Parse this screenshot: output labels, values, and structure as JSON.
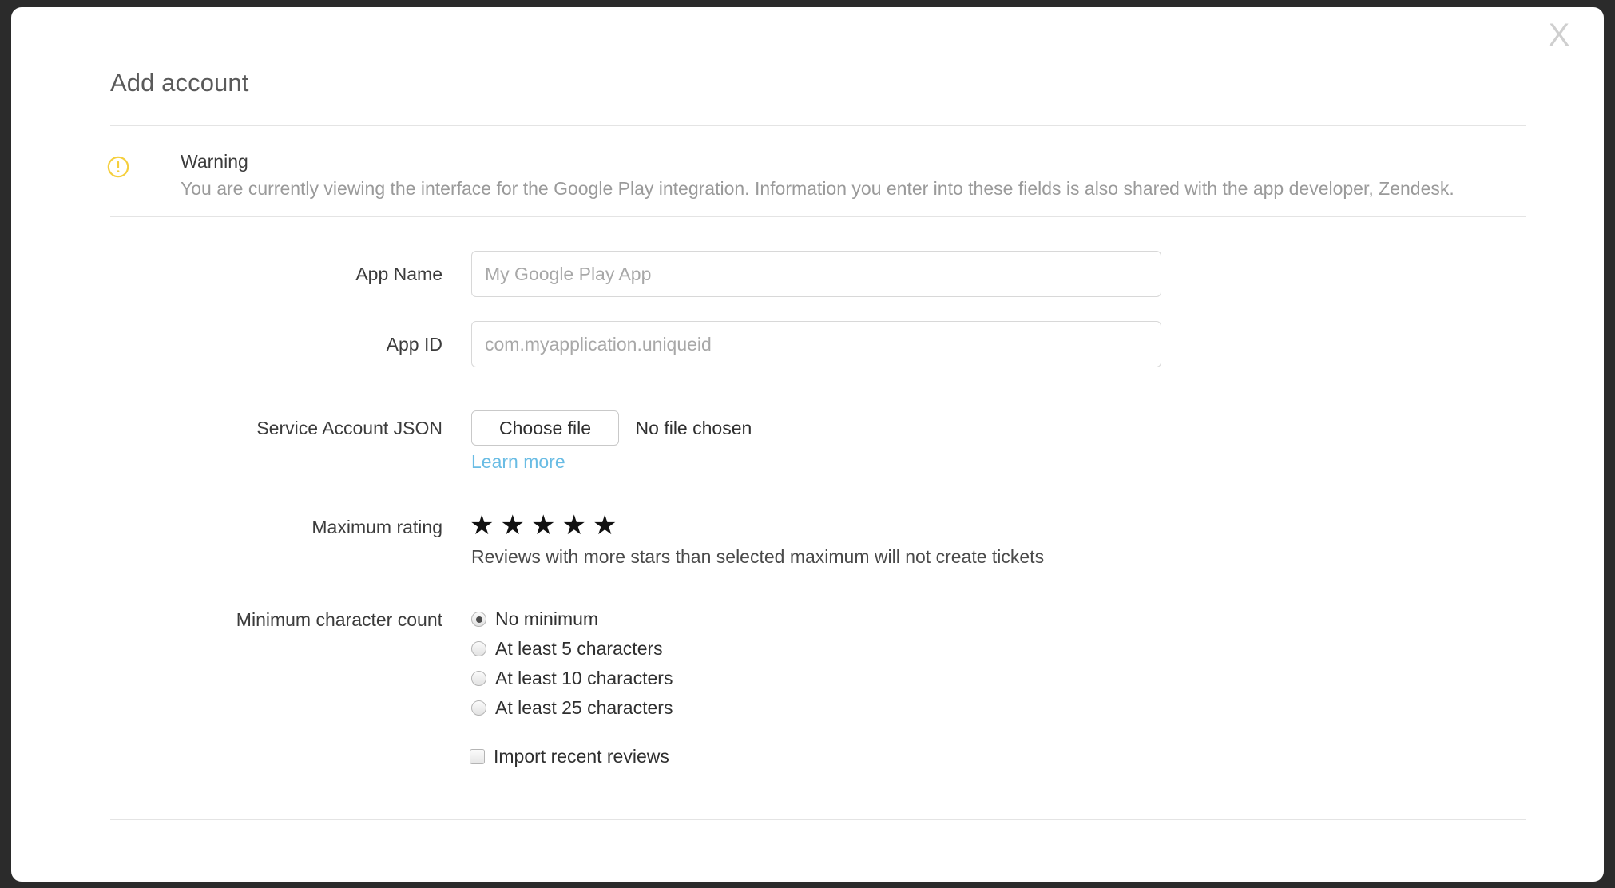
{
  "window": {
    "close_label": "X"
  },
  "dialog": {
    "title": "Add account"
  },
  "warning": {
    "icon": "warning-circle-icon",
    "title": "Warning",
    "message": "You are currently viewing the interface for the Google Play integration. Information you enter into these fields is also shared with the app developer, Zendesk.",
    "icon_color": "#f5cf3d"
  },
  "form": {
    "app_name": {
      "label": "App Name",
      "value": "",
      "placeholder": "My Google Play App"
    },
    "app_id": {
      "label": "App ID",
      "value": "",
      "placeholder": "com.myapplication.uniqueid"
    },
    "service_account_json": {
      "label": "Service Account JSON",
      "choose_file_label": "Choose file",
      "file_status": "No file chosen",
      "learn_more_label": "Learn more",
      "learn_more_color": "#69bce4"
    },
    "maximum_rating": {
      "label": "Maximum rating",
      "stars_total": 5,
      "stars_selected": 5,
      "star_glyph": "★",
      "help_text": "Reviews with more stars than selected maximum will not create tickets"
    },
    "minimum_character_count": {
      "label": "Minimum character count",
      "selected_index": 0,
      "options": [
        {
          "label": "No minimum"
        },
        {
          "label": "At least 5 characters"
        },
        {
          "label": "At least 10 characters"
        },
        {
          "label": "At least 25 characters"
        }
      ]
    },
    "import_recent_reviews": {
      "label": "Import recent reviews",
      "checked": false
    }
  }
}
